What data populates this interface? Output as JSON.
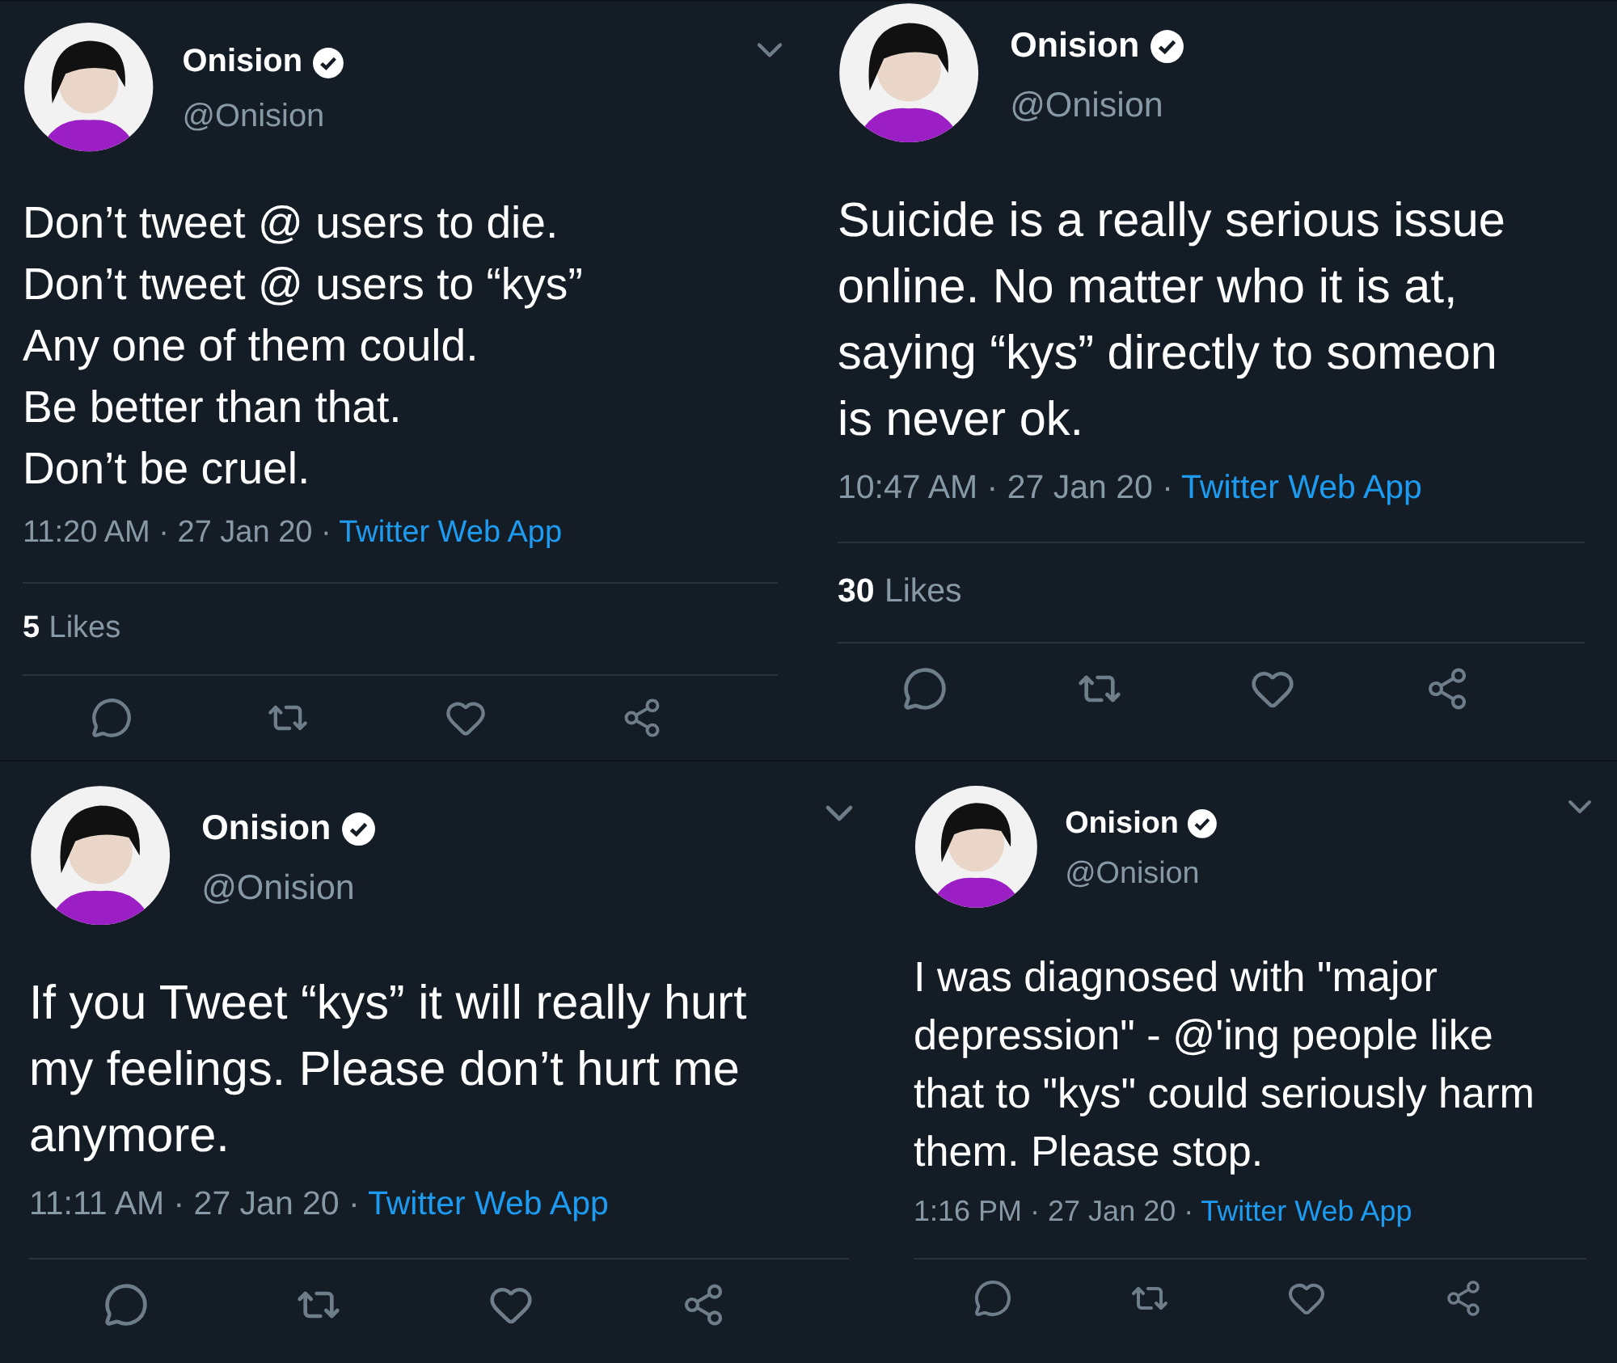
{
  "tweets": [
    {
      "name": "Onision",
      "verified": true,
      "handle": "@Onision",
      "menu_caret": true,
      "body_lines": [
        "Don’t tweet @ users to die.",
        "Don’t tweet @ users to “kys”",
        "Any one of them could.",
        "Be better than that.",
        "Don’t be cruel."
      ],
      "meta": "11:20 AM · 27 Jan 20 ·",
      "source": "Twitter Web App",
      "likes": {
        "count": "5",
        "label": "Likes"
      }
    },
    {
      "name": "Onision",
      "verified": true,
      "handle": "@Onision",
      "menu_caret": false,
      "body_lines": [
        "Suicide is a really serious issue",
        "online. No matter who it is at,",
        "saying “kys” directly to someon",
        "is never ok."
      ],
      "meta": "10:47 AM · 27 Jan 20 ·",
      "source": "Twitter Web App",
      "likes": {
        "count": "30",
        "label": "Likes"
      }
    },
    {
      "name": "Onision",
      "verified": true,
      "handle": "@Onision",
      "menu_caret": true,
      "body_lines": [
        "If you Tweet “kys” it will really hurt",
        "my feelings. Please don’t hurt me",
        "anymore."
      ],
      "meta": "11:11 AM · 27 Jan 20 ·",
      "source": "Twitter Web App"
    },
    {
      "name": "Onision",
      "verified": true,
      "handle": "@Onision",
      "menu_caret": true,
      "body_lines": [
        "I was diagnosed with \"major",
        "depression\" - @'ing people like",
        "that to \"kys\" could seriously harm",
        "them. Please stop."
      ],
      "meta": "1:16 PM · 27 Jan 20 ·",
      "source": "Twitter Web App"
    }
  ]
}
